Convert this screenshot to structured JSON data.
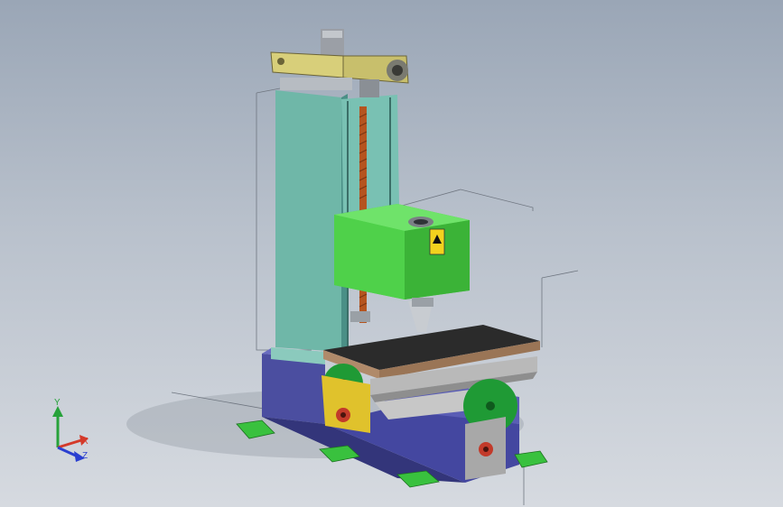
{
  "viewport": {
    "background_top": "#9aa6b6",
    "background_bottom": "#d6dae0"
  },
  "model": {
    "colors": {
      "column": "#6fb7a8",
      "column_dark": "#4a8f86",
      "head": "#4fd14a",
      "head_dark": "#2f9a2c",
      "base": "#4b4ea0",
      "base_dark": "#33357a",
      "table_top": "#b08a6a",
      "table_grid": "#2b2b2b",
      "slide": "#b9b9b9",
      "handwheel": "#1f9a35",
      "handwheel_light": "#3ec45a",
      "motor_bracket": "#d8cf7a",
      "bracket_yellow": "#e0c22c",
      "screw": "#b5541f",
      "foot": "#39c13e",
      "warning": "#f3d21e"
    }
  },
  "triad": {
    "x_label": "X",
    "y_label": "Y",
    "z_label": "Z",
    "icons": [
      "y-axis-arrow-icon",
      "x-axis-arrow-icon",
      "z-axis-arrow-icon"
    ],
    "x_color": "#d43a2a",
    "y_color": "#27a23a",
    "z_color": "#2a3fd0"
  }
}
